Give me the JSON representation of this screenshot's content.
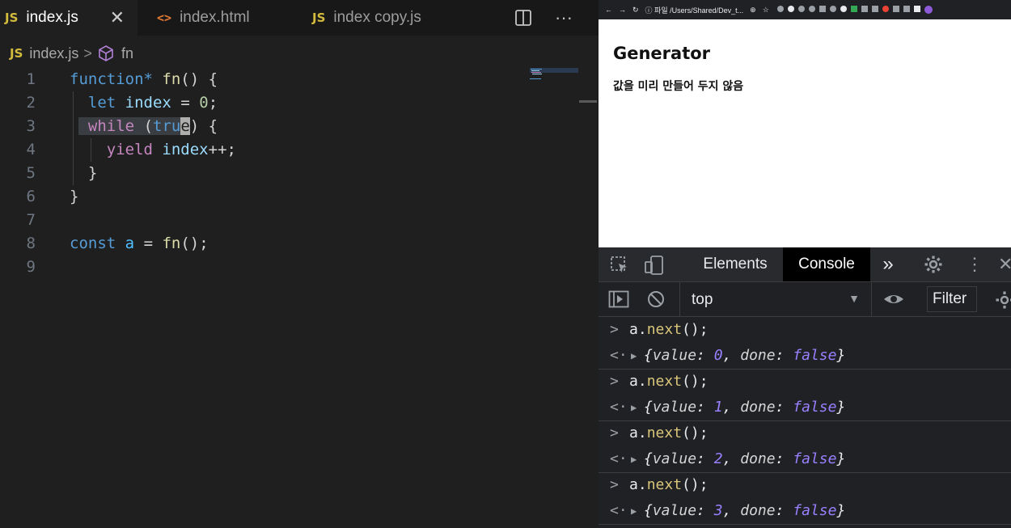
{
  "editor": {
    "tabs": [
      {
        "icon": "JS",
        "label": "index.js",
        "close": "✕"
      },
      {
        "icon": "<>",
        "label": "index.html"
      },
      {
        "icon": "JS",
        "label": "index copy.js"
      }
    ],
    "more": "···",
    "breadcrumb": {
      "icon": "JS",
      "file": "index.js",
      "sep": ">",
      "symbol": "fn"
    },
    "line_numbers": [
      "1",
      "2",
      "3",
      "4",
      "5",
      "6",
      "7",
      "8",
      "9"
    ]
  },
  "browser": {
    "address": "ⓘ 파일  /Users/Shared/Dev_t...",
    "heading": "Generator",
    "text": "값을 미리 만들어 두지 않음"
  },
  "devtools": {
    "tabs": {
      "elements": "Elements",
      "console": "Console",
      "more": "»"
    },
    "context": "top",
    "filter": "Filter",
    "entries": [
      {
        "input": "a.next();",
        "value": "0",
        "done": "false"
      },
      {
        "input": "a.next();",
        "value": "1",
        "done": "false"
      },
      {
        "input": "a.next();",
        "value": "2",
        "done": "false"
      },
      {
        "input": "a.next();",
        "value": "3",
        "done": "false"
      }
    ]
  }
}
